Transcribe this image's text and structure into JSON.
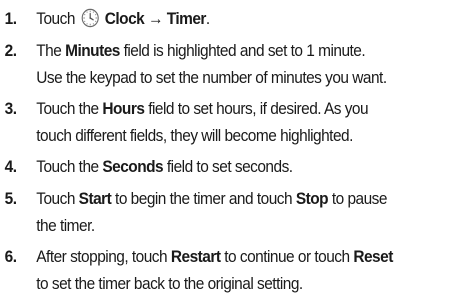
{
  "steps": [
    {
      "number": "1.",
      "lines": [
        {
          "parts": [
            "Touch",
            "Clock → Timer",
            "."
          ]
        }
      ]
    },
    {
      "number": "2.",
      "lines": [
        {
          "parts": [
            "The ",
            "Minutes",
            " field is highlighted and set to 1 minute."
          ]
        },
        {
          "parts": [
            "Use the keypad to set the number of minutes you want."
          ]
        }
      ]
    },
    {
      "number": "3.",
      "lines": [
        {
          "parts": [
            "Touch the ",
            "Hours",
            " field to set hours, if desired. As you"
          ]
        },
        {
          "parts": [
            "touch different fields, they will become highlighted."
          ]
        }
      ]
    },
    {
      "number": "4.",
      "lines": [
        {
          "parts": [
            "Touch the ",
            "Seconds",
            " field to set seconds."
          ]
        }
      ]
    },
    {
      "number": "5.",
      "lines": [
        {
          "parts": [
            "Touch ",
            "Start",
            " to begin the timer and touch ",
            "Stop",
            " to pause"
          ]
        },
        {
          "parts": [
            "the timer."
          ]
        }
      ]
    },
    {
      "number": "6.",
      "lines": [
        {
          "parts": [
            "After stopping, touch ",
            "Restart",
            " to continue or touch ",
            "Reset"
          ]
        },
        {
          "parts": [
            "to set the timer back to the original setting."
          ]
        }
      ]
    }
  ],
  "icons": {
    "clock": "clock-icon"
  }
}
